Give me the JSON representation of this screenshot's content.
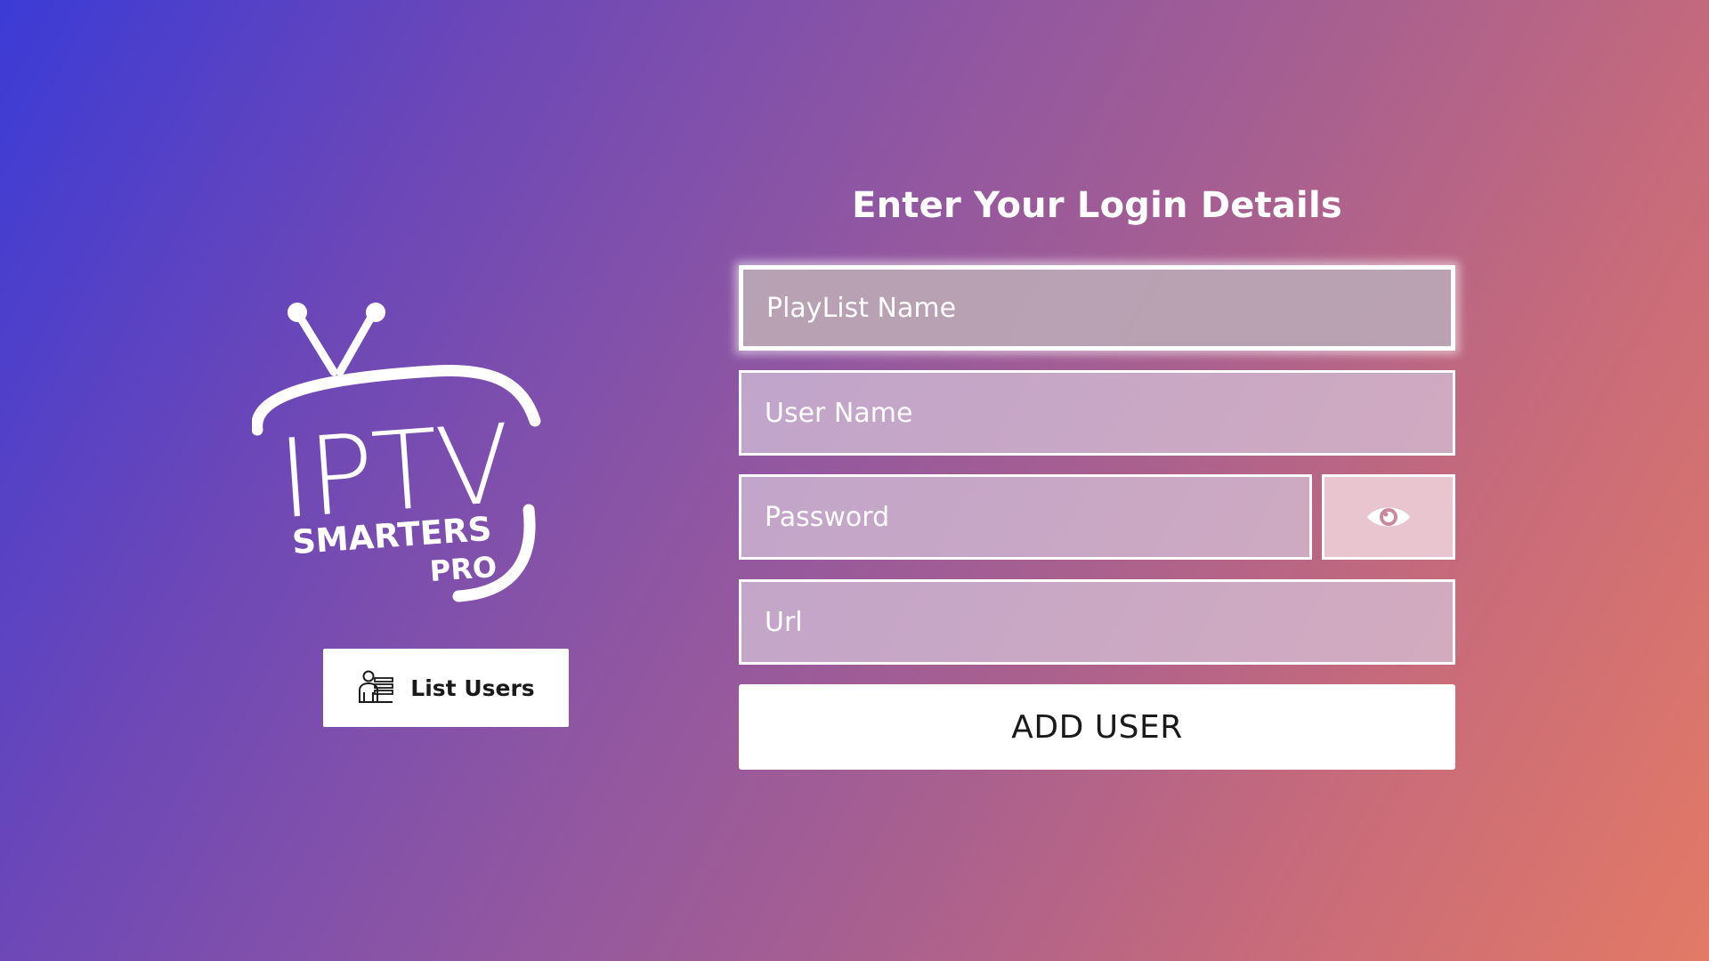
{
  "brand": {
    "logo_text_main": "IPTV",
    "logo_text_sub": "SMARTERS",
    "logo_text_edition": "PRO"
  },
  "sidebar": {
    "list_users_label": "List Users",
    "list_users_icon": "users-list-icon"
  },
  "form": {
    "title": "Enter Your Login Details",
    "playlist_placeholder": "PlayList Name",
    "username_placeholder": "User Name",
    "password_placeholder": "Password",
    "password_toggle_icon": "eye-icon",
    "url_placeholder": "Url",
    "submit_label": "ADD USER"
  },
  "colors": {
    "gradient_start": "#3b3bd6",
    "gradient_end": "#e37a66",
    "button_bg": "#ffffff",
    "button_text": "#1a1a1a"
  }
}
